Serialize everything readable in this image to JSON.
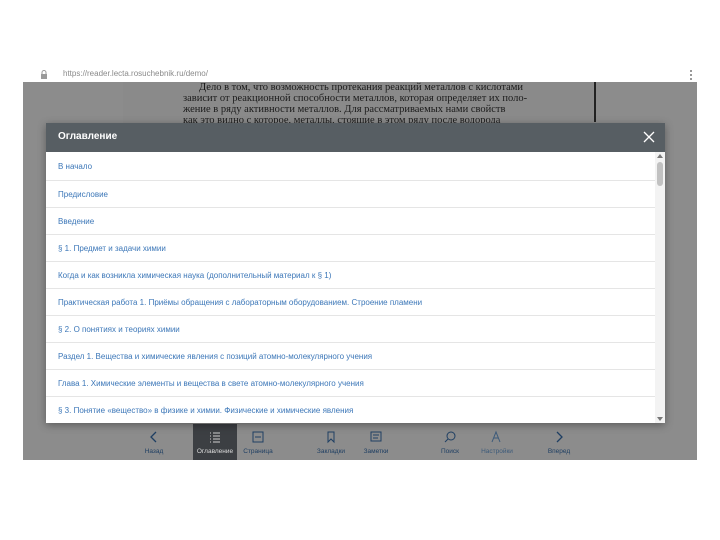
{
  "browser": {
    "url": "https://reader.lecta.rosuchebnik.ru/demo/"
  },
  "page": {
    "lines": [
      "Дело в том, что возможность протекания реакций металлов с кислотами",
      "зависит от реакционной способности металлов, которая определяет их поло-",
      "жение в ряду активности металлов. Для рассматриваемых нами свойств",
      "как это видно с которое, металлы, стоящие в этом ряду после водорода"
    ]
  },
  "toc": {
    "title": "Оглавление",
    "items": [
      "В начало",
      "Предисловие",
      "Введение",
      "§ 1. Предмет и задачи химии",
      "Когда и как возникла химическая наука (дополнительный материал к § 1)",
      "Практическая работа 1. Приёмы обращения с лабораторным оборудованием. Строение пламени",
      "§ 2. О понятиях и теориях химии",
      "Раздел 1. Вещества и химические явления с позиций атомно-молекулярного учения",
      "Глава 1. Химические элементы и вещества в свете атомно-молекулярного учения",
      "§ 3. Понятие «вещество» в физике и химии. Физические и химические явления"
    ]
  },
  "toolbar": {
    "items": [
      {
        "label": "Назад",
        "icon": "chevron-left-icon"
      },
      {
        "label": "Оглавление",
        "icon": "list-icon"
      },
      {
        "label": "Страница",
        "icon": "page-icon"
      },
      {
        "label": "Закладки",
        "icon": "bookmark-icon"
      },
      {
        "label": "Заметки",
        "icon": "notes-icon"
      },
      {
        "label": "Поиск",
        "icon": "search-icon"
      },
      {
        "label": "Настройки",
        "icon": "font-settings-icon"
      },
      {
        "label": "Вперед",
        "icon": "chevron-right-icon"
      }
    ]
  },
  "colors": {
    "modal_header": "#575e63",
    "link": "#3c77b8",
    "reader_bg": "#8c8c8c",
    "toolbar_active": "#3c3f43"
  }
}
